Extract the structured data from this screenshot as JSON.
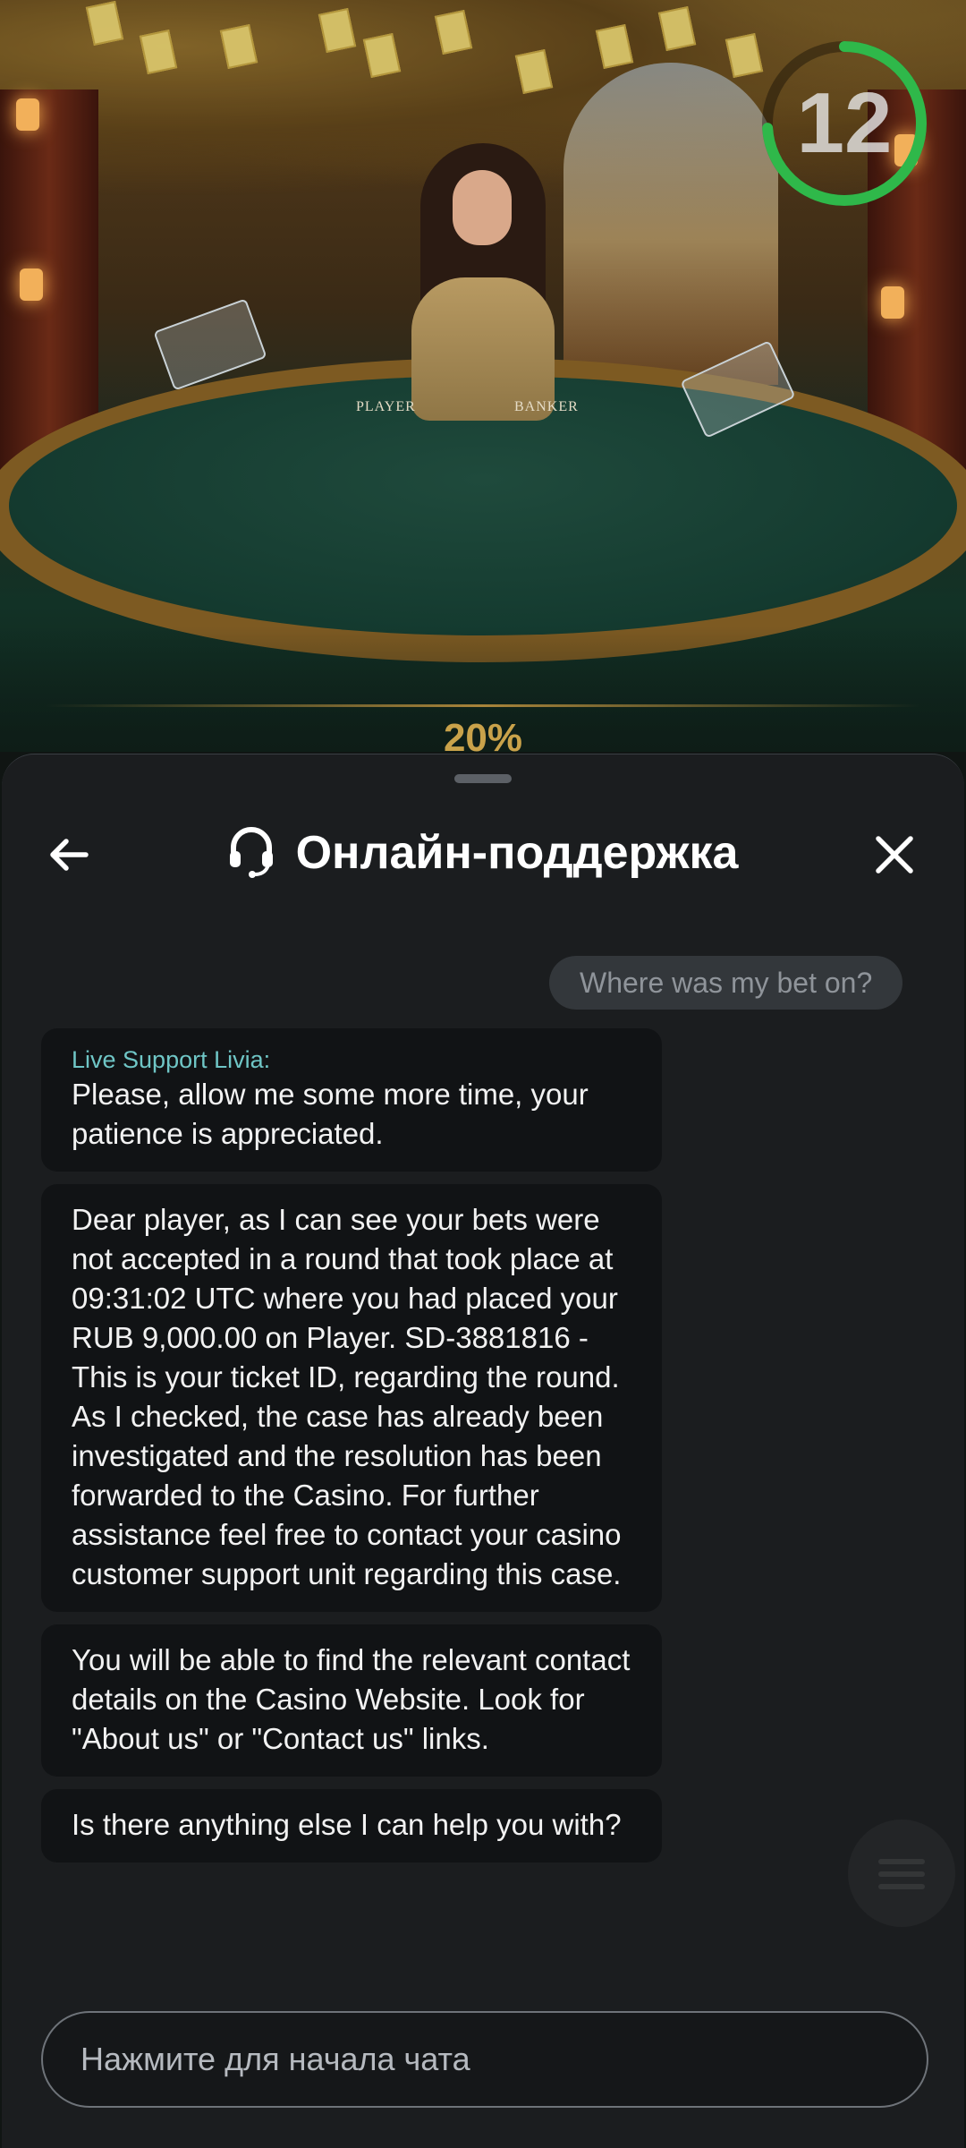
{
  "game": {
    "timer": "12",
    "table_labels": [
      "PLAYER",
      "BANKER"
    ],
    "payout_percent": "20%"
  },
  "colors": {
    "timer_ring": "#2fb84a",
    "sender_name": "#6fc6c6",
    "panel_bg": "#1c1e20",
    "bubble_bg": "#111315"
  },
  "chat": {
    "title": "Онлайн-поддержка",
    "header_icon": "headset-icon",
    "back_icon": "arrow-left-icon",
    "close_icon": "close-icon",
    "user_message": "Where was my bet on?",
    "messages": [
      {
        "sender": "Live Support Livia:",
        "text": "Please, allow me some more time, your patience is appreciated."
      },
      {
        "text": "Dear player, as I can see your bets were not accepted in a round that took place at 09:31:02 UTC where you had placed your RUB 9,000.00 on Player. SD-3881816 - This is your ticket ID, regarding the round. As I checked, the case has already been investigated and the resolution has been forwarded to the Casino. For further assistance feel free to contact your casino customer support unit regarding this case."
      },
      {
        "text": "You will be able to find the relevant contact details on the Casino Website. Look for \"About us\" or \"Contact us\" links."
      },
      {
        "text": "Is there anything else I can help you with?"
      }
    ],
    "input_placeholder": "Нажмите для начала чата"
  }
}
